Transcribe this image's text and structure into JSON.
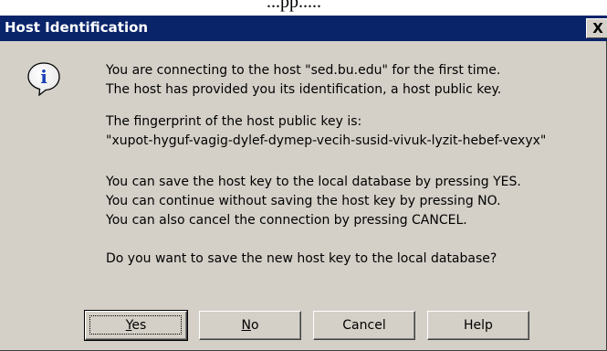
{
  "fragment_text": "...pp.....",
  "dialog": {
    "title": "Host Identification",
    "close_glyph": "X",
    "icon": "info-icon",
    "icon_glyph": "i",
    "lines": [
      "You are connecting to the host \"sed.bu.edu\" for the first time.",
      "The host has provided you its identification, a host public key.",
      "The fingerprint of the host public key is:",
      "\"xupot-hyguf-vagig-dylef-dymep-vecih-susid-vivuk-lyzit-hebef-vexyx\"",
      "You can save the host key to the local database by pressing YES.",
      "You can continue without saving the host key by pressing NO.",
      "You can also cancel the connection by pressing CANCEL.",
      "Do you want to save the new host key to the local database?"
    ],
    "buttons": [
      {
        "label_first": "Y",
        "label_rest": "es",
        "access_key": "Y"
      },
      {
        "label_first": "N",
        "label_rest": "o",
        "access_key": "N"
      },
      {
        "label": "Cancel"
      },
      {
        "label": "Help"
      }
    ]
  },
  "colors": {
    "titlebar": "#0a246a",
    "face": "#d4d0c8",
    "icon_blue": "#1a3fb8"
  }
}
